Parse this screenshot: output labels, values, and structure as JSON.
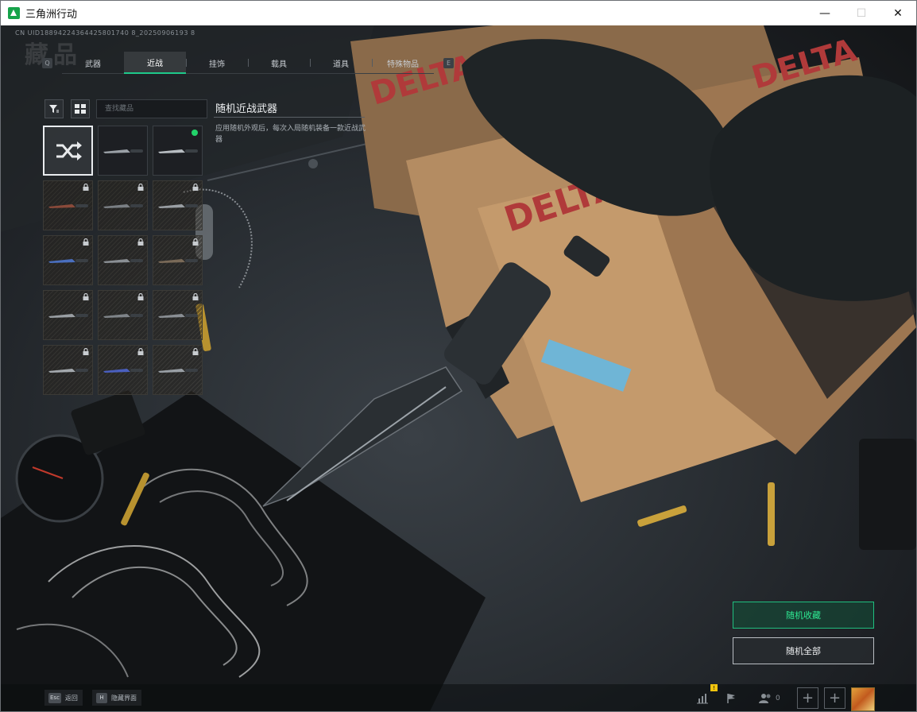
{
  "window": {
    "title": "三角洲行动",
    "controls": {
      "minimize": "—",
      "maximize": "☐",
      "close": "✕"
    }
  },
  "header": {
    "uid": "CN UID18894224364425801740 8_20250906193 8",
    "page_title": "藏品"
  },
  "tabs": {
    "left_key": "Q",
    "right_key": "E",
    "items": [
      {
        "label": "武器",
        "active": false
      },
      {
        "label": "近战",
        "active": true
      },
      {
        "label": "挂饰",
        "active": false
      },
      {
        "label": "载具",
        "active": false
      },
      {
        "label": "道具",
        "active": false
      },
      {
        "label": "特殊物品",
        "active": false
      }
    ]
  },
  "search": {
    "placeholder": "查找藏品",
    "value": ""
  },
  "detail": {
    "title": "随机近战武器",
    "description": "应用随机外观后，每次入局随机装备一款近战武器"
  },
  "grid": {
    "items": [
      {
        "kind": "random",
        "locked": false,
        "equipped": false,
        "selected": true
      },
      {
        "kind": "knife",
        "locked": false,
        "equipped": false,
        "selected": false
      },
      {
        "kind": "knife",
        "locked": false,
        "equipped": true,
        "selected": false
      },
      {
        "kind": "knife",
        "locked": true
      },
      {
        "kind": "knife",
        "locked": true
      },
      {
        "kind": "knife",
        "locked": true
      },
      {
        "kind": "knife",
        "locked": true
      },
      {
        "kind": "knife",
        "locked": true
      },
      {
        "kind": "knife",
        "locked": true
      },
      {
        "kind": "knife",
        "locked": true
      },
      {
        "kind": "knife",
        "locked": true
      },
      {
        "kind": "knife",
        "locked": true
      },
      {
        "kind": "knife",
        "locked": true
      },
      {
        "kind": "knife",
        "locked": true
      },
      {
        "kind": "knife",
        "locked": true
      }
    ]
  },
  "actions": {
    "random_collection": "随机收藏",
    "random_all": "随机全部"
  },
  "bottom": {
    "back_key": "Esc",
    "back_label": "返回",
    "hide_key": "H",
    "hide_label": "隐藏界面",
    "notification_badge": "!",
    "friend_count": "0"
  },
  "colors": {
    "accent": "#1ec98a",
    "equipped_dot": "#22d36a",
    "badge": "#f1c40f"
  },
  "icons": [
    "filter-icon",
    "grid-view-icon",
    "shuffle-icon",
    "lock-icon",
    "stats-icon",
    "flag-icon",
    "friends-icon",
    "plus-icon"
  ]
}
